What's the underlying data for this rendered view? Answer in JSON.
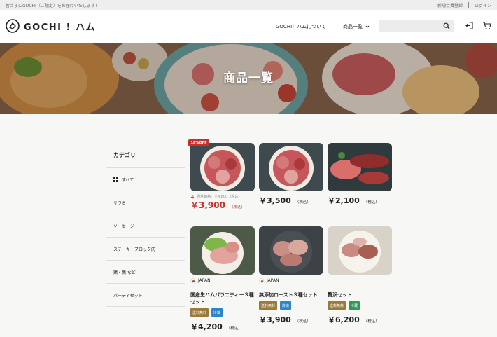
{
  "topbar": {
    "announcement": "皆さまにGOCHI（ご馳走）をお届けいたします！",
    "register": "新規会員登録",
    "login": "ログイン"
  },
  "header": {
    "logo_text": "GOCHI ! ハム",
    "nav": [
      {
        "label": "GOCHI！ハムについて"
      },
      {
        "label": "商品一覧"
      }
    ],
    "search_placeholder": ""
  },
  "hero": {
    "title": "商品一覧"
  },
  "sidebar": {
    "title": "カテゴリ",
    "items": [
      {
        "label": "すべて"
      },
      {
        "label": "サラミ"
      },
      {
        "label": "ソーセージ"
      },
      {
        "label": "ステーキ・ブロック肉"
      },
      {
        "label": "鶏・鴨 など"
      },
      {
        "label": "パーティセット"
      }
    ]
  },
  "products": [
    {
      "badge": "18%OFF",
      "regular": "通常価格：￥4,800（税込）",
      "price": "￥3,900",
      "tax": "（税込）"
    },
    {
      "price": "￥3,500",
      "tax": "（税込）"
    },
    {
      "price": "￥2,100",
      "tax": "（税込）"
    },
    {
      "origin": "JAPAN",
      "name": "国産生ハムバラエティー３種セット",
      "tags": [
        "送料無料",
        "冷凍"
      ],
      "price": "￥4,200",
      "tax": "（税込）"
    },
    {
      "origin": "JAPAN",
      "name": "無添加ロースト３種セット",
      "tags": [
        "送料無料",
        "冷凍"
      ],
      "price": "￥3,900",
      "tax": "（税込）"
    },
    {
      "origin": "",
      "name": "贅沢セット",
      "tags": [
        "送料無料",
        "冷蔵"
      ],
      "price": "￥6,200",
      "tax": "（税込）"
    }
  ],
  "colors": {
    "sale_red": "#c9302c",
    "tag_brown": "#9a7a3a",
    "tag_blue": "#2a86c8",
    "tag_green": "#2e9a5a"
  }
}
